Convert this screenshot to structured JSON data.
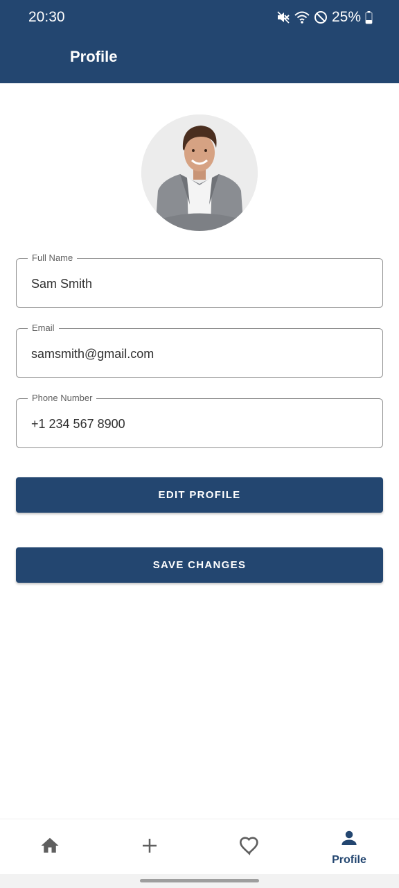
{
  "status_bar": {
    "time": "20:30",
    "battery": "25%",
    "icons": [
      "mute-icon",
      "wifi-icon",
      "dnd-icon",
      "battery-icon"
    ]
  },
  "app_bar": {
    "title": "Profile"
  },
  "avatar": {
    "icon": "profile-photo"
  },
  "form": {
    "full_name": {
      "label": "Full Name",
      "value": "Sam Smith"
    },
    "email": {
      "label": "Email",
      "value": "samsmith@gmail.com"
    },
    "phone": {
      "label": "Phone Number",
      "value": "+1 234 567 8900"
    }
  },
  "buttons": {
    "edit": "EDIT PROFILE",
    "save": "SAVE CHANGES"
  },
  "bottom_nav": {
    "items": [
      {
        "icon": "home-icon",
        "label": ""
      },
      {
        "icon": "plus-icon",
        "label": ""
      },
      {
        "icon": "heart-icon",
        "label": ""
      },
      {
        "icon": "person-icon",
        "label": "Profile"
      }
    ],
    "active_index": 3
  },
  "colors": {
    "primary": "#234670",
    "background": "#ffffff",
    "field_border": "#8f8f8f",
    "inactive_icon": "#5f5f5f"
  }
}
